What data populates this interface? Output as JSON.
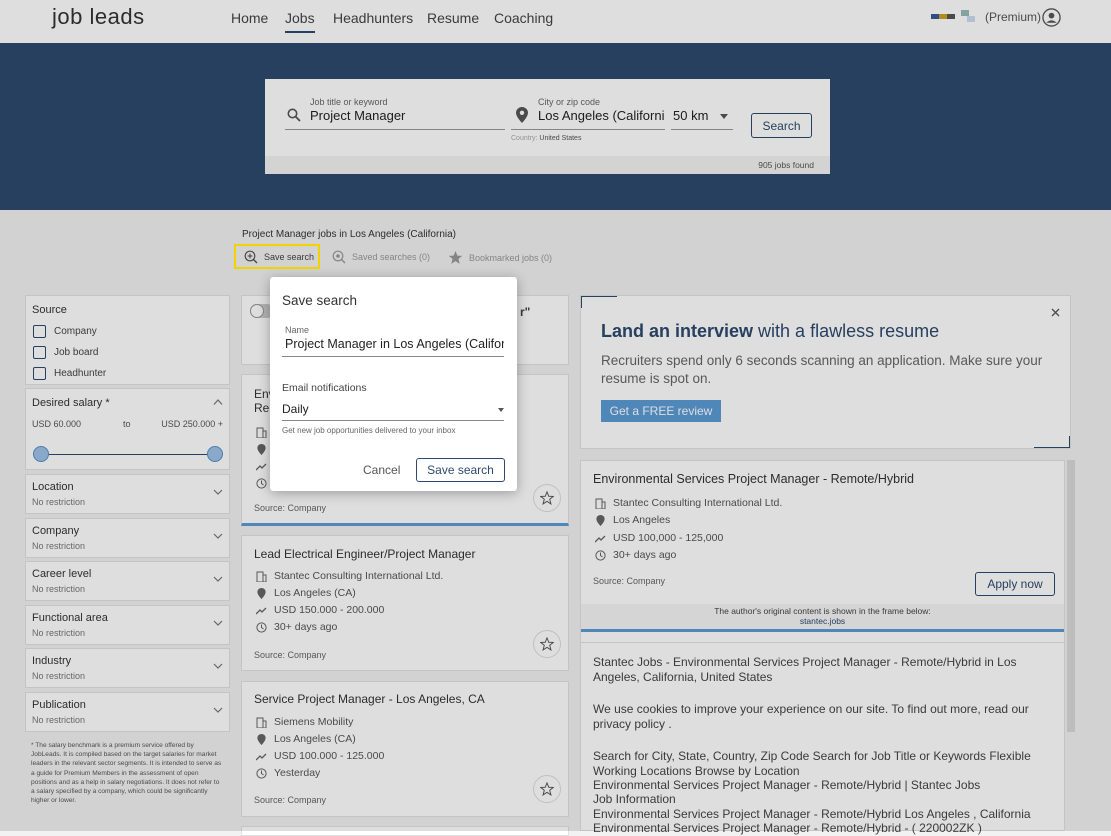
{
  "header": {
    "logo": "job leads",
    "nav": [
      "Home",
      "Jobs",
      "Headhunters",
      "Resume",
      "Coaching"
    ],
    "account_label": "(Premium)"
  },
  "search": {
    "keyword_label": "Job title or keyword",
    "keyword_value": "Project Manager",
    "city_label": "City or zip code",
    "city_value": "Los Angeles (California)",
    "country_prefix": "Country:",
    "country_value": "United States",
    "radius": "50 km",
    "button": "Search",
    "results_count": "905 jobs found"
  },
  "results": {
    "title": "Project Manager jobs in Los Angeles (California)",
    "save_search": "Save search",
    "saved_searches": "Saved searches (0)",
    "bookmarked": "Bookmarked jobs (0)"
  },
  "sidebar": {
    "source_title": "Source",
    "source_options": [
      "Company",
      "Job board",
      "Headhunter"
    ],
    "salary_title": "Desired salary *",
    "salary_min": "USD 60.000",
    "salary_to": "to",
    "salary_max": "USD 250.000 +",
    "filters": [
      {
        "title": "Location",
        "sub": "No restriction"
      },
      {
        "title": "Company",
        "sub": "No restriction"
      },
      {
        "title": "Career level",
        "sub": "No restriction"
      },
      {
        "title": "Functional area",
        "sub": "No restriction"
      },
      {
        "title": "Industry",
        "sub": "No restriction"
      },
      {
        "title": "Publication",
        "sub": "No restriction"
      }
    ],
    "footnote": "* The salary benchmark is a premium service offered by JobLeads. It is compiled based on the target salaries for market leaders in the relevant sector segments. It is intended to serve as a guide for Premium Members in the assessment of open positions and as a help in salary negotiations. It does not refer to a salary specified by a company, which could be significantly higher or lower."
  },
  "jobs": [
    {
      "title": "Env",
      "title2": "Rem",
      "source": "Source: Company"
    },
    {
      "title": "Lead Electrical Engineer/Project Manager",
      "company": "Stantec Consulting International Ltd.",
      "location": "Los Angeles (CA)",
      "salary": "USD 150.000 - 200.000",
      "age": "30+ days ago",
      "source": "Source: Company"
    },
    {
      "title": "Service Project Manager - Los Angeles, CA",
      "company": "Siemens Mobility",
      "location": "Los Angeles (CA)",
      "salary": "USD 100.000 - 125.000",
      "age": "Yesterday",
      "source": "Source: Company"
    }
  ],
  "alert_card": {
    "title_tail": "r\""
  },
  "ad": {
    "headline_bold": "Land an interview",
    "headline_rest": " with a flawless resume",
    "body": "Recruiters spend only 6 seconds scanning an application. Make sure your resume is spot on.",
    "cta": "Get a FREE review"
  },
  "detail": {
    "title": "Environmental Services Project Manager - Remote/Hybrid",
    "company": "Stantec Consulting International Ltd.",
    "location": "Los Angeles",
    "salary": "USD 100,000 - 125,000",
    "age": "30+ days ago",
    "source": "Source: Company",
    "apply": "Apply now",
    "frame_note": "The author's original content is shown in the frame below:",
    "frame_domain": "stantec.jobs",
    "frame_lines": [
      "Stantec Jobs - Environmental Services Project Manager - Remote/Hybrid in Los Angeles, California, United States",
      "We use cookies to improve your experience on our site. To find out more, read our privacy policy .",
      "Search for City, State, Country, Zip Code Search for Job Title or Keywords Flexible Working Locations Browse by Location",
      "Environmental Services Project Manager - Remote/Hybrid | Stantec Jobs",
      "Job Information",
      "Environmental Services Project Manager - Remote/Hybrid Los Angeles , California",
      "Environmental Services Project Manager - Remote/Hybrid - ( 220002ZK )"
    ]
  },
  "modal": {
    "title": "Save search",
    "name_label": "Name",
    "name_value": "Project Manager in Los Angeles (California)",
    "notif_label": "Email notifications",
    "notif_value": "Daily",
    "notif_hint": "Get new job opportunities delivered to your inbox",
    "cancel": "Cancel",
    "save": "Save search"
  },
  "colors": {
    "brand": "#2d4a6e",
    "highlight": "#f2d300",
    "cta": "#5b9bd5"
  }
}
